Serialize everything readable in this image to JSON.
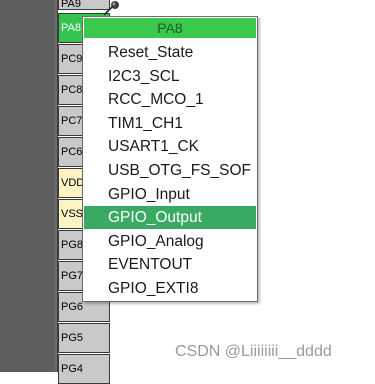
{
  "colors": {
    "chip_body": "#5e5e5e",
    "pin_default": "#c9c9c9",
    "pin_assigned": "#35c24f",
    "pin_power": "#fdf3c3",
    "menu_header": "#3ac84d",
    "menu_selected": "#3aaa62"
  },
  "pins": {
    "partial_top": "PA9",
    "pa8": "PA8",
    "pc9": "PC9",
    "pc8": "PC8",
    "pc7": "PC7",
    "pc6": "PC6",
    "vdd": "VDD",
    "vss": "VSS",
    "pg8": "PG8",
    "pg7": "PG7",
    "pg6": "PG6",
    "pg5": "PG5",
    "pg4": "PG4"
  },
  "pin_menu": {
    "title": "PA8",
    "selected_index": 7,
    "items": [
      "Reset_State",
      "I2C3_SCL",
      "RCC_MCO_1",
      "TIM1_CH1",
      "USART1_CK",
      "USB_OTG_FS_SOF",
      "GPIO_Input",
      "GPIO_Output",
      "GPIO_Analog",
      "EVENTOUT",
      "GPIO_EXTI8"
    ]
  },
  "watermark": "CSDN @Liiiiiiii__dddd",
  "icons": {
    "pushpin": "pushpin-icon"
  }
}
